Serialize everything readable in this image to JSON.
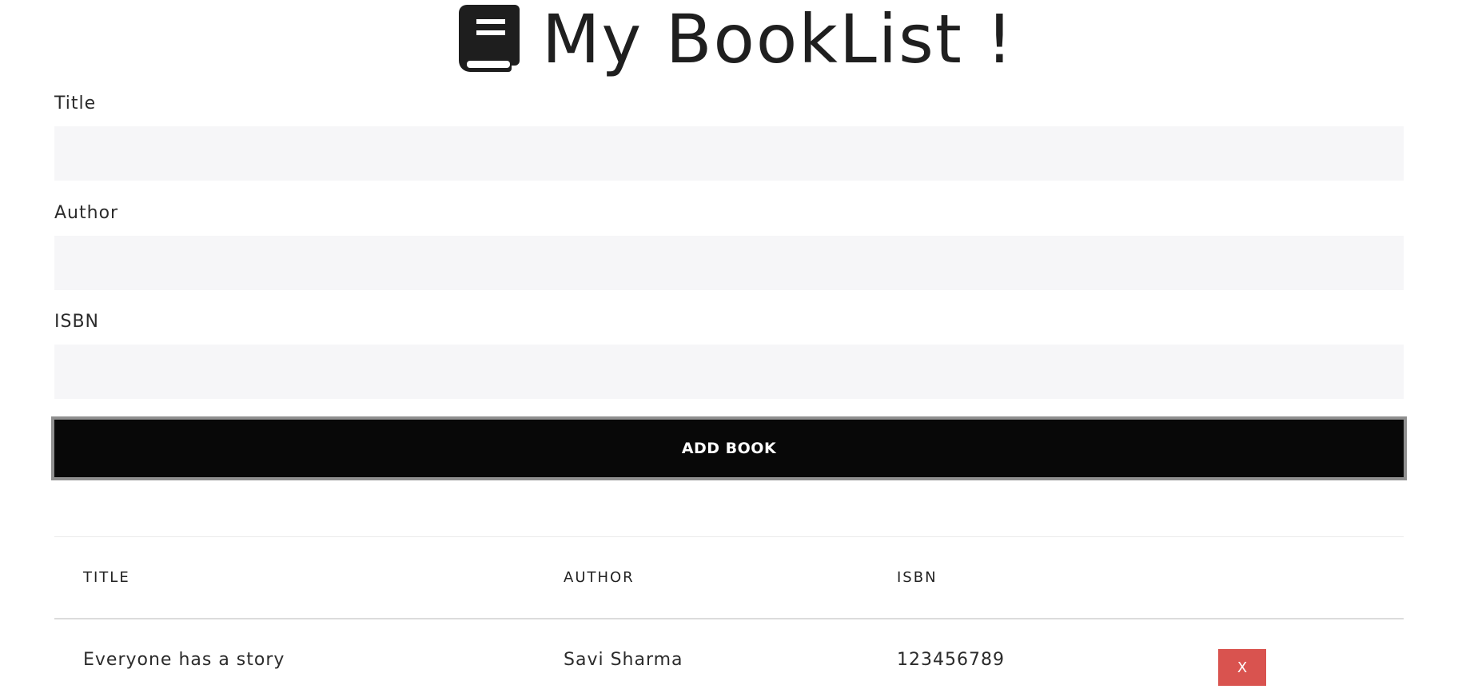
{
  "header": {
    "title": "My BookList !",
    "icon": "book-icon"
  },
  "form": {
    "title_label": "Title",
    "title_value": "",
    "author_label": "Author",
    "author_value": "",
    "isbn_label": "ISBN",
    "isbn_value": "",
    "submit_label": "ADD BOOK"
  },
  "table": {
    "columns": [
      "TITLE",
      "AUTHOR",
      "ISBN"
    ],
    "rows": [
      {
        "title": "Everyone has a story",
        "author": "Savi Sharma",
        "isbn": "123456789",
        "delete_label": "X"
      }
    ]
  },
  "colors": {
    "button_bg": "#080808",
    "button_border": "#8f8f8f",
    "input_bg": "#f6f6f8",
    "delete_bg": "#d9534f"
  }
}
